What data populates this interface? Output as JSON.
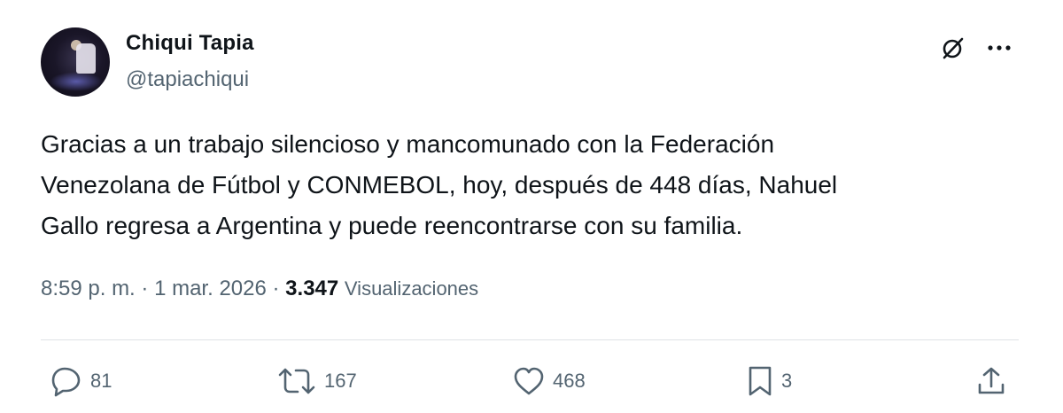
{
  "author": {
    "display_name": "Chiqui Tapia",
    "handle": "@tapiachiqui"
  },
  "tweet": {
    "text": "Gracias a un trabajo silencioso y mancomunado con la Federación\nVenezolana de Fútbol y CONMEBOL, hoy, después de 448 días, Nahuel\nGallo regresa a Argentina y puede reencontrarse con su familia.",
    "time": "8:59 p. m.",
    "separator": "·",
    "date": "1 mar. 2026",
    "views_count": "3.347",
    "views_label": "Visualizaciones"
  },
  "actions": {
    "reply_count": "81",
    "repost_count": "167",
    "like_count": "468",
    "bookmark_count": "3"
  },
  "icons": {
    "grok": "grok-icon",
    "more": "more-icon",
    "reply": "reply-icon",
    "repost": "repost-icon",
    "like": "heart-icon",
    "bookmark": "bookmark-icon",
    "share": "share-icon"
  },
  "colors": {
    "text": "#0f1419",
    "secondary": "#536471",
    "divider": "#dfe3e6"
  }
}
